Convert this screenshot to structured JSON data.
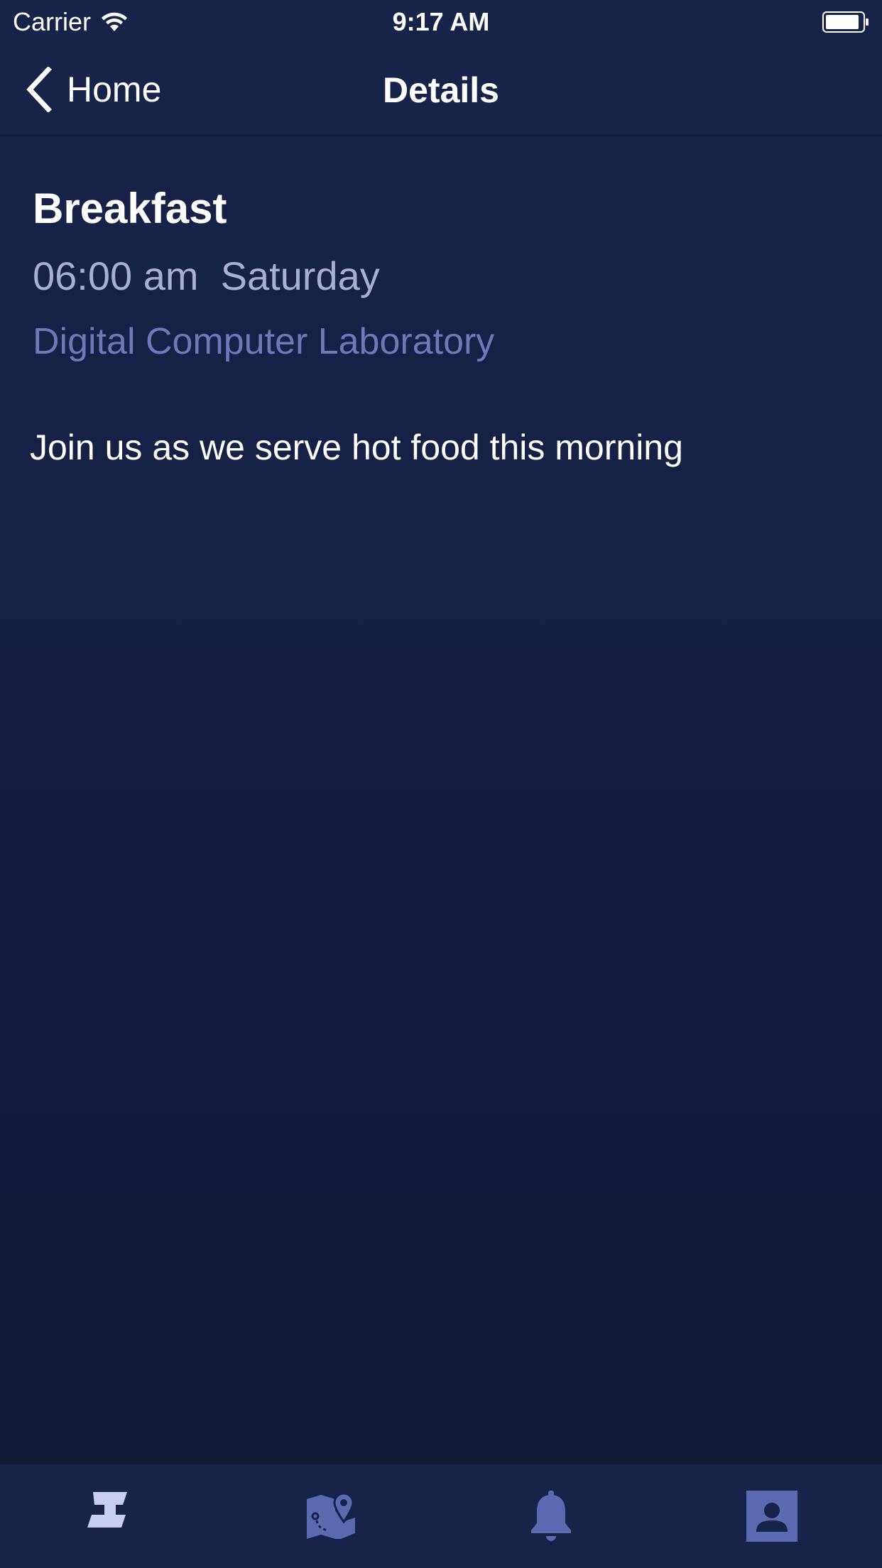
{
  "status_bar": {
    "carrier": "Carrier",
    "time": "9:17 AM"
  },
  "nav": {
    "back_label": "Home",
    "title": "Details"
  },
  "event": {
    "title": "Breakfast",
    "time": "06:00 am  Saturday",
    "location": "Digital Computer Laboratory",
    "description": "Join us as we serve hot food this morning"
  },
  "tab_bar": {
    "tabs": [
      {
        "icon": "schedule-icon",
        "active": true
      },
      {
        "icon": "map-icon",
        "active": false
      },
      {
        "icon": "bell-icon",
        "active": false
      },
      {
        "icon": "profile-icon",
        "active": false
      }
    ]
  },
  "colors": {
    "background": "#18234a",
    "time_text": "#a9aed6",
    "location_text": "#6f78b8",
    "tab_active": "#c9ccf5",
    "tab_inactive": "#5c68b0"
  }
}
